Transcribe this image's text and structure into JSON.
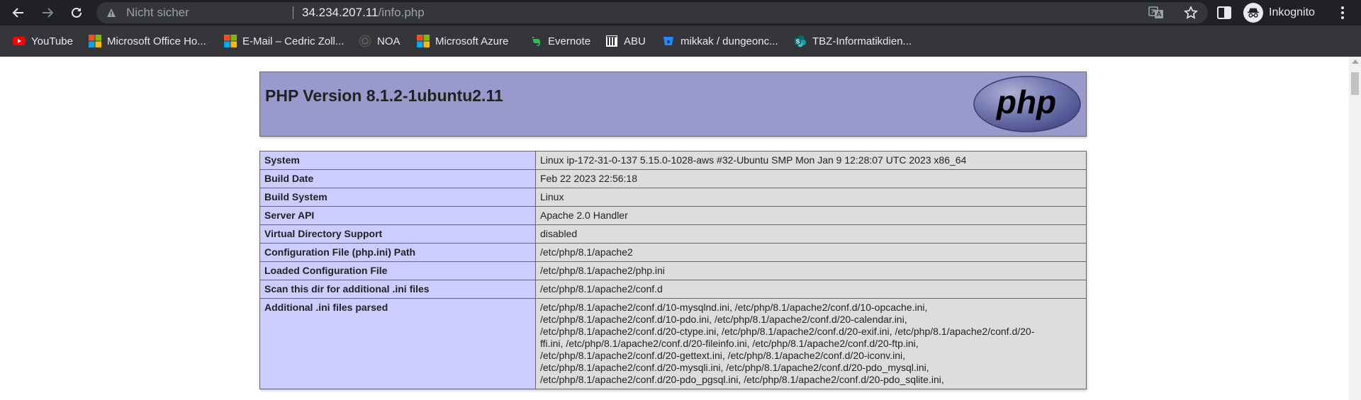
{
  "browser": {
    "security_label": "Nicht sicher",
    "url_host": "34.234.207.11",
    "url_path": "/info.php",
    "profile_label": "Inkognito"
  },
  "bookmarks": [
    {
      "label": "YouTube",
      "icon": "youtube-icon"
    },
    {
      "label": "Microsoft Office Ho...",
      "icon": "microsoft-icon"
    },
    {
      "label": "E-Mail – Cedric Zoll...",
      "icon": "microsoft-icon"
    },
    {
      "label": "NOA",
      "icon": "noa-icon"
    },
    {
      "label": "Microsoft Azure",
      "icon": "microsoft-icon"
    },
    {
      "label": "Evernote",
      "icon": "evernote-icon"
    },
    {
      "label": "ABU",
      "icon": "library-icon"
    },
    {
      "label": "mikkak / dungeonc...",
      "icon": "bitbucket-icon"
    },
    {
      "label": "TBZ-Informatikdien...",
      "icon": "sharepoint-icon"
    }
  ],
  "phpinfo": {
    "title": "PHP Version 8.1.2-1ubuntu2.11",
    "logo_text": "php",
    "rows": [
      {
        "key": "System",
        "value": "Linux ip-172-31-0-137 5.15.0-1028-aws #32-Ubuntu SMP Mon Jan 9 12:28:07 UTC 2023 x86_64"
      },
      {
        "key": "Build Date",
        "value": "Feb 22 2023 22:56:18"
      },
      {
        "key": "Build System",
        "value": "Linux"
      },
      {
        "key": "Server API",
        "value": "Apache 2.0 Handler"
      },
      {
        "key": "Virtual Directory Support",
        "value": "disabled"
      },
      {
        "key": "Configuration File (php.ini) Path",
        "value": "/etc/php/8.1/apache2"
      },
      {
        "key": "Loaded Configuration File",
        "value": "/etc/php/8.1/apache2/php.ini"
      },
      {
        "key": "Scan this dir for additional .ini files",
        "value": "/etc/php/8.1/apache2/conf.d"
      },
      {
        "key": "Additional .ini files parsed",
        "value_lines": [
          "/etc/php/8.1/apache2/conf.d/10-mysqlnd.ini, /etc/php/8.1/apache2/conf.d/10-opcache.ini,",
          "/etc/php/8.1/apache2/conf.d/10-pdo.ini, /etc/php/8.1/apache2/conf.d/20-calendar.ini,",
          "/etc/php/8.1/apache2/conf.d/20-ctype.ini, /etc/php/8.1/apache2/conf.d/20-exif.ini, /etc/php/8.1/apache2/conf.d/20-",
          "ffi.ini, /etc/php/8.1/apache2/conf.d/20-fileinfo.ini, /etc/php/8.1/apache2/conf.d/20-ftp.ini,",
          "/etc/php/8.1/apache2/conf.d/20-gettext.ini, /etc/php/8.1/apache2/conf.d/20-iconv.ini,",
          "/etc/php/8.1/apache2/conf.d/20-mysqli.ini, /etc/php/8.1/apache2/conf.d/20-pdo_mysql.ini,",
          "/etc/php/8.1/apache2/conf.d/20-pdo_pgsql.ini, /etc/php/8.1/apache2/conf.d/20-pdo_sqlite.ini,"
        ]
      }
    ]
  },
  "colors": {
    "header_bg": "#9999cc",
    "key_cell_bg": "#ccccff",
    "value_cell_bg": "#dddddd",
    "toolbar_bg": "#202124",
    "bookmarks_bg": "#35363a"
  }
}
